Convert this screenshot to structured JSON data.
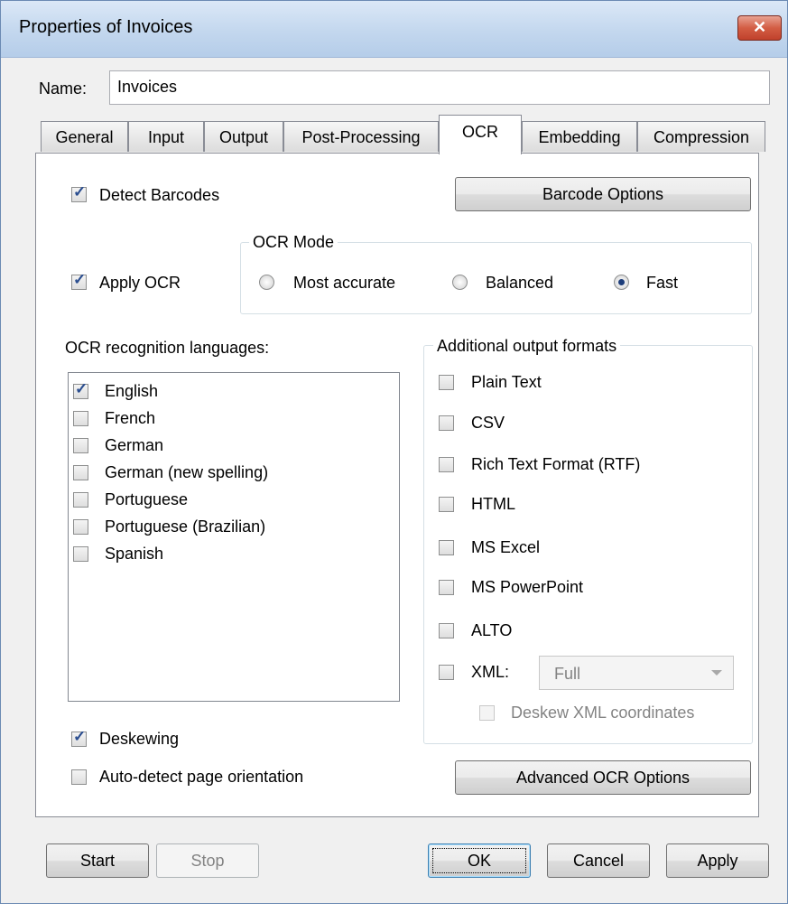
{
  "window": {
    "title": "Properties of Invoices",
    "close_glyph": "✕"
  },
  "name_field": {
    "label": "Name:",
    "value": "Invoices"
  },
  "tabs": [
    {
      "label": "General"
    },
    {
      "label": "Input"
    },
    {
      "label": "Output"
    },
    {
      "label": "Post-Processing"
    },
    {
      "label": "OCR"
    },
    {
      "label": "Embedding"
    },
    {
      "label": "Compression"
    }
  ],
  "active_tab": "OCR",
  "ocr_tab": {
    "detect_barcodes": {
      "label": "Detect Barcodes",
      "checked": true
    },
    "barcode_options_button": "Barcode Options",
    "apply_ocr": {
      "label": "Apply OCR",
      "checked": true
    },
    "ocr_mode": {
      "title": "OCR Mode",
      "options": [
        "Most accurate",
        "Balanced",
        "Fast"
      ],
      "selected": "Fast"
    },
    "languages": {
      "label": "OCR recognition languages:",
      "items": [
        {
          "label": "English",
          "checked": true
        },
        {
          "label": "French",
          "checked": false
        },
        {
          "label": "German",
          "checked": false
        },
        {
          "label": "German (new spelling)",
          "checked": false
        },
        {
          "label": "Portuguese",
          "checked": false
        },
        {
          "label": "Portuguese (Brazilian)",
          "checked": false
        },
        {
          "label": "Spanish",
          "checked": false
        }
      ]
    },
    "output_formats": {
      "title": "Additional output formats",
      "items": [
        {
          "label": "Plain Text",
          "checked": false
        },
        {
          "label": "CSV",
          "checked": false
        },
        {
          "label": "Rich Text Format (RTF)",
          "checked": false
        },
        {
          "label": "HTML",
          "checked": false
        },
        {
          "label": "MS Excel",
          "checked": false
        },
        {
          "label": "MS PowerPoint",
          "checked": false
        },
        {
          "label": "ALTO",
          "checked": false
        },
        {
          "label": "XML:",
          "checked": false
        }
      ],
      "xml_mode": {
        "value": "Full",
        "disabled": true
      },
      "deskew_xml": {
        "label": "Deskew XML coordinates",
        "checked": false,
        "disabled": true
      }
    },
    "deskewing": {
      "label": "Deskewing",
      "checked": true
    },
    "auto_detect_orientation": {
      "label": "Auto-detect page orientation",
      "checked": false
    },
    "advanced_button": "Advanced OCR Options"
  },
  "footer": {
    "start": "Start",
    "stop": "Stop",
    "ok": "OK",
    "cancel": "Cancel",
    "apply": "Apply"
  },
  "colors": {
    "title_bar": "#c3d7ee",
    "close_button": "#c0412b",
    "checkbox_check": "#2a4d8f"
  }
}
